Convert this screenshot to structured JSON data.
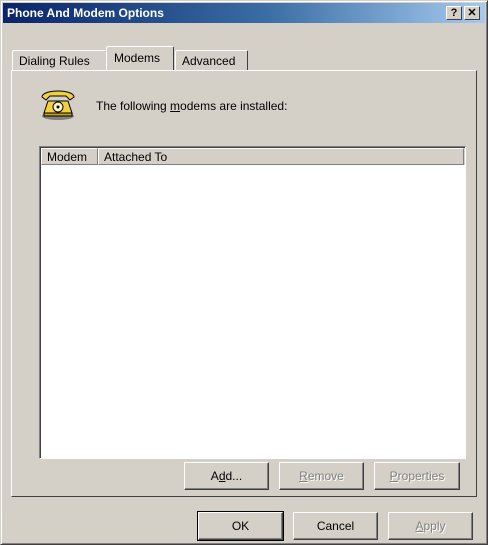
{
  "window": {
    "title": "Phone And Modem Options",
    "help_label": "?",
    "close_label": "✕"
  },
  "tabs": [
    {
      "label": "Dialing Rules",
      "active": false
    },
    {
      "label": "Modems",
      "active": true
    },
    {
      "label": "Advanced",
      "active": false
    }
  ],
  "modems_page": {
    "icon": "telephone-icon",
    "installed_text_before": "The following ",
    "installed_text_mnemonic": "m",
    "installed_text_after": "odems are  installed:",
    "columns": [
      "Modem",
      "Attached To"
    ],
    "rows": [],
    "add_button": {
      "pre": "A",
      "mnemonic": "d",
      "post": "d...",
      "enabled": true
    },
    "remove_button": {
      "pre": "",
      "mnemonic": "R",
      "post": "emove",
      "enabled": false
    },
    "properties_button": {
      "pre": "",
      "mnemonic": "P",
      "post": "roperties",
      "enabled": false
    }
  },
  "dialog_buttons": {
    "ok_label": "OK",
    "cancel_label": "Cancel",
    "apply_pre": "",
    "apply_mnemonic": "A",
    "apply_post": "pply"
  }
}
